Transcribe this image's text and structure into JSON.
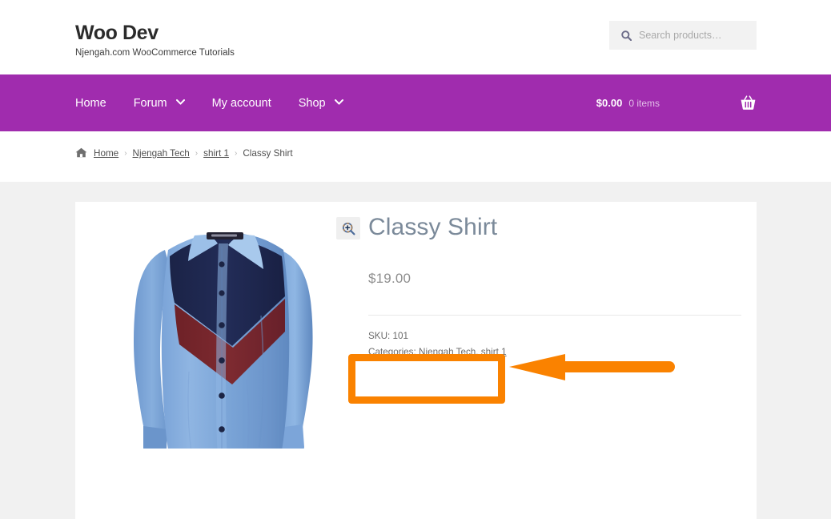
{
  "header": {
    "brand_title": "Woo Dev",
    "brand_tagline": "Njengah.com WooCommerce Tutorials",
    "search": {
      "icon": "search-icon",
      "placeholder": "Search products…",
      "value": ""
    }
  },
  "nav": {
    "background_color": "#a02cae",
    "items": [
      {
        "label": "Home",
        "has_dropdown": false
      },
      {
        "label": "Forum",
        "has_dropdown": true
      },
      {
        "label": "My account",
        "has_dropdown": false
      },
      {
        "label": "Shop",
        "has_dropdown": true
      }
    ],
    "cart": {
      "amount": "$0.00",
      "count": "0 items",
      "icon": "shopping-basket-icon"
    }
  },
  "breadcrumb": {
    "home_icon": "home-icon",
    "separator": "›",
    "items": [
      {
        "label": "Home",
        "is_link": true
      },
      {
        "label": "Njengah Tech",
        "is_link": true
      },
      {
        "label": "shirt 1",
        "is_link": true
      },
      {
        "label": "Classy Shirt",
        "is_link": false
      }
    ]
  },
  "product": {
    "title": "Classy Shirt",
    "price": "$19.00",
    "sku_label": "SKU:",
    "sku_value": "101",
    "categories_label": "Categories:",
    "categories": [
      {
        "label": "Njengah Tech"
      },
      {
        "label": "shirt 1"
      }
    ],
    "categories_text": "Njengah Tech, shirt 1",
    "gallery": {
      "zoom_icon": "magnifier-plus-icon",
      "image_alt": "blue dress shirt with navy and maroon chevron panels"
    }
  },
  "annotation": {
    "color": "#fa8200",
    "box": {
      "name": "add-to-cart-highlight-box",
      "text": ""
    },
    "arrow": {
      "name": "annotation-arrow",
      "direction": "left"
    }
  },
  "theme": {
    "page_background": "#f1f1f1",
    "card_background": "#ffffff",
    "accent_purple": "#a02cae",
    "title_color": "#7b8a9a",
    "annotation_orange": "#fa8200"
  }
}
